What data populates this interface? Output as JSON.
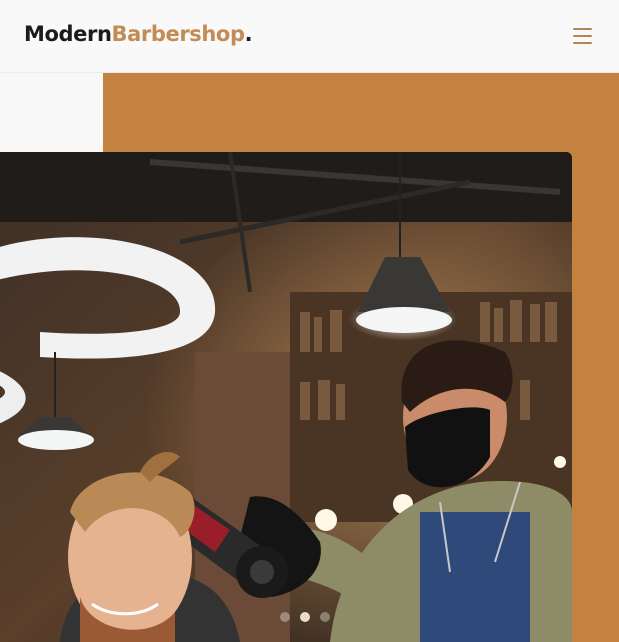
{
  "brand": {
    "part1": "Modern",
    "part2": "Barbershop",
    "part3": "."
  },
  "nav": {
    "menu_icon": "hamburger-menu-icon"
  },
  "hero": {
    "image_subject": "barber-drying-client-hair-photo"
  },
  "slider": {
    "slide_count": 3,
    "active_index": 1
  },
  "colors": {
    "brand_accent": "#c38b55",
    "panel": "#c3823f",
    "header_bg": "#f9f9f9",
    "text_dark": "#1b1b1b"
  }
}
